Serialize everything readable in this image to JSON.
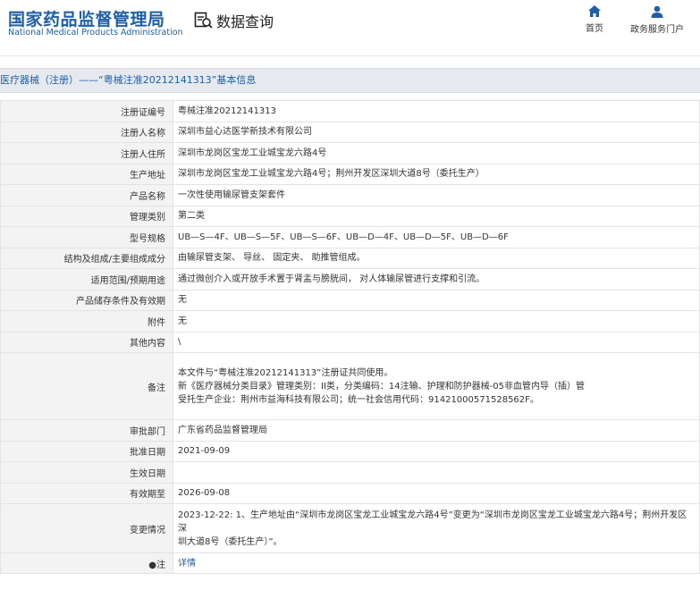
{
  "header": {
    "logo_cn": "国家药品监督管理局",
    "logo_en": "National Medical Products Administration",
    "query_label": "数据查询",
    "nav_home": "首页",
    "nav_portal": "政务服务门户",
    "accent_color": "#1f5fa6"
  },
  "breadcrumb": "医疗器械（注册）——“粤械注准20212141313”基本信息",
  "rows": [
    {
      "label": "注册证编号",
      "value": "粤械注准20212141313"
    },
    {
      "label": "注册人名称",
      "value": "深圳市益心达医学新技术有限公司"
    },
    {
      "label": "注册人住所",
      "value": "深圳市龙岗区宝龙工业城宝龙六路4号"
    },
    {
      "label": "生产地址",
      "value": "深圳市龙岗区宝龙工业城宝龙六路4号；荆州开发区深圳大道8号（委托生产）"
    },
    {
      "label": "产品名称",
      "value": "一次性使用输尿管支架套件"
    },
    {
      "label": "管理类别",
      "value": "第二类"
    },
    {
      "label": "型号规格",
      "value": "UB—S—4F、UB—S—5F、UB—S—6F、UB—D—4F、UB—D—5F、UB—D—6F"
    },
    {
      "label": "结构及组成/主要组成成分",
      "value": "由输尿管支架、 导丝、 固定夹、 助推管组成。"
    },
    {
      "label": "适用范围/预期用途",
      "value": "通过微创介入或开放手术置于肾盂与膀胱间， 对人体输尿管进行支撑和引流。"
    },
    {
      "label": "产品储存条件及有效期",
      "value": "无"
    },
    {
      "label": "附件",
      "value": "无"
    },
    {
      "label": "其他内容",
      "value": "\\"
    }
  ],
  "remark": {
    "label": "备注",
    "line1": "本文件与“粤械注准20212141313”注册证共同使用。",
    "line2": "新《医疗器械分类目录》管理类别：II类，分类编码：14注输、护理和防护器械-05非血管内导（插）管",
    "line3": "受托生产企业：荆州市益海科技有限公司；统一社会信用代码：91421000571528562F。"
  },
  "rows2": [
    {
      "label": "审批部门",
      "value": "广东省药品监督管理局"
    },
    {
      "label": "批准日期",
      "value": "2021-09-09"
    },
    {
      "label": "生效日期",
      "value": ""
    },
    {
      "label": "有效期至",
      "value": "2026-09-08"
    }
  ],
  "change": {
    "label": "变更情况",
    "line1": "2023-12-22: 1、生产地址由“深圳市龙岗区宝龙工业城宝龙六路4号”变更为“深圳市龙岗区宝龙工业城宝龙六路4号；荆州开发区深",
    "line2": "圳大道8号（委托生产）”。"
  },
  "note": {
    "label": "●注",
    "link": "详情"
  }
}
